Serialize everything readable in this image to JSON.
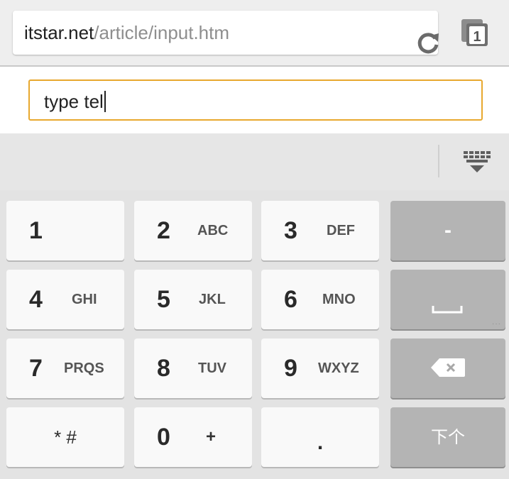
{
  "browser": {
    "url_domain": "itstar.net",
    "url_path": "/article/input.htm",
    "tab_count": "1",
    "reload_icon": "reload-icon",
    "tabs_icon": "tab-switcher-icon"
  },
  "page": {
    "input_value": "type tel"
  },
  "keyboard": {
    "hide_icon": "keyboard-hide-icon",
    "keys": {
      "k1": {
        "num": "1",
        "letters": ""
      },
      "k2": {
        "num": "2",
        "letters": "ABC"
      },
      "k3": {
        "num": "3",
        "letters": "DEF"
      },
      "k4": {
        "num": "4",
        "letters": "GHI"
      },
      "k5": {
        "num": "5",
        "letters": "JKL"
      },
      "k6": {
        "num": "6",
        "letters": "MNO"
      },
      "k7": {
        "num": "7",
        "letters": "PRQS"
      },
      "k8": {
        "num": "8",
        "letters": "TUV"
      },
      "k9": {
        "num": "9",
        "letters": "WXYZ"
      },
      "k0": {
        "num": "0",
        "letters": "+"
      },
      "star": "* #",
      "dot": ".",
      "minus": "-",
      "next": "下个"
    },
    "space_icon": "space-bar-icon",
    "backspace_icon": "backspace-icon"
  }
}
